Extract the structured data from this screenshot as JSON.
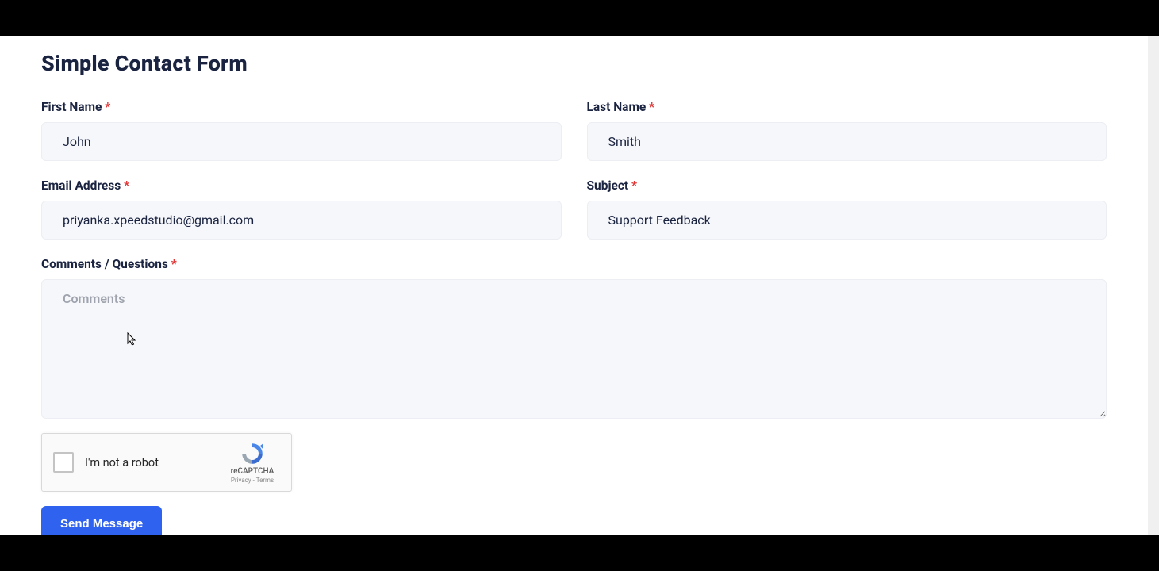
{
  "title": "Simple Contact Form",
  "fields": {
    "first_name": {
      "label": "First Name",
      "value": "John"
    },
    "last_name": {
      "label": "Last Name",
      "value": "Smith"
    },
    "email": {
      "label": "Email Address",
      "value": "priyanka.xpeedstudio@gmail.com"
    },
    "subject": {
      "label": "Subject",
      "value": "Support Feedback"
    },
    "comments": {
      "label": "Comments / Questions",
      "placeholder": "Comments",
      "value": ""
    }
  },
  "required_marker": "*",
  "recaptcha": {
    "checkbox_label": "I'm not a robot",
    "brand": "reCAPTCHA",
    "legal_privacy": "Privacy",
    "legal_terms": "Terms",
    "legal_sep": " - "
  },
  "submit_label": "Send Message"
}
